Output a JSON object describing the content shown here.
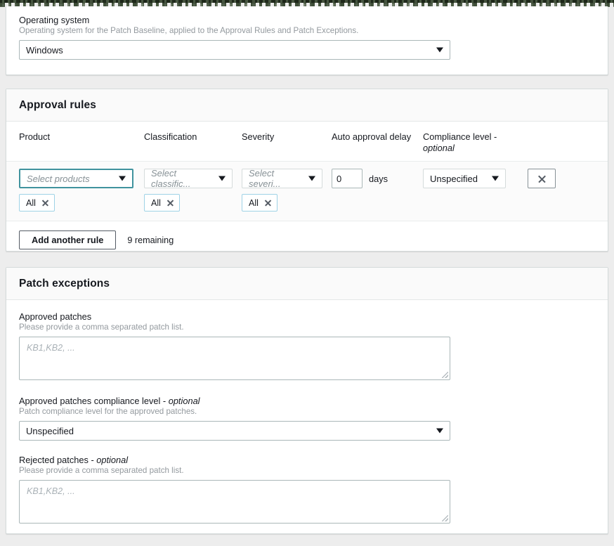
{
  "operating_system": {
    "label": "Operating system",
    "description": "Operating system for the Patch Baseline, applied to the Approval Rules and Patch Exceptions.",
    "selected": "Windows"
  },
  "approval_rules": {
    "title": "Approval rules",
    "columns": {
      "product": "Product",
      "classification": "Classification",
      "severity": "Severity",
      "auto_approval_delay": "Auto approval delay",
      "compliance_level": "Compliance level -",
      "compliance_level_optional": "optional"
    },
    "rows": [
      {
        "product_placeholder": "Select products",
        "product_tokens": [
          "All"
        ],
        "classification_placeholder": "Select classific...",
        "classification_tokens": [
          "All"
        ],
        "severity_placeholder": "Select severi...",
        "severity_tokens": [
          "All"
        ],
        "delay_value": "0",
        "delay_unit": "days",
        "compliance_level": "Unspecified"
      }
    ],
    "add_rule_label": "Add another rule",
    "remaining_label": "9 remaining"
  },
  "patch_exceptions": {
    "title": "Patch exceptions",
    "approved_patches": {
      "label": "Approved patches",
      "description": "Please provide a comma separated patch list.",
      "placeholder": "KB1,KB2, ...",
      "value": ""
    },
    "approved_compliance": {
      "label": "Approved patches compliance level -",
      "label_optional": "optional",
      "description": "Patch compliance level for the approved patches.",
      "selected": "Unspecified"
    },
    "rejected_patches": {
      "label": "Rejected patches -",
      "label_optional": "optional",
      "description": "Please provide a comma separated patch list.",
      "placeholder": "KB1,KB2, ...",
      "value": ""
    }
  },
  "colors": {
    "focus_border": "#40939e",
    "token_border": "#9fd2e6",
    "text": "#16191f",
    "muted_text": "#93999e"
  }
}
